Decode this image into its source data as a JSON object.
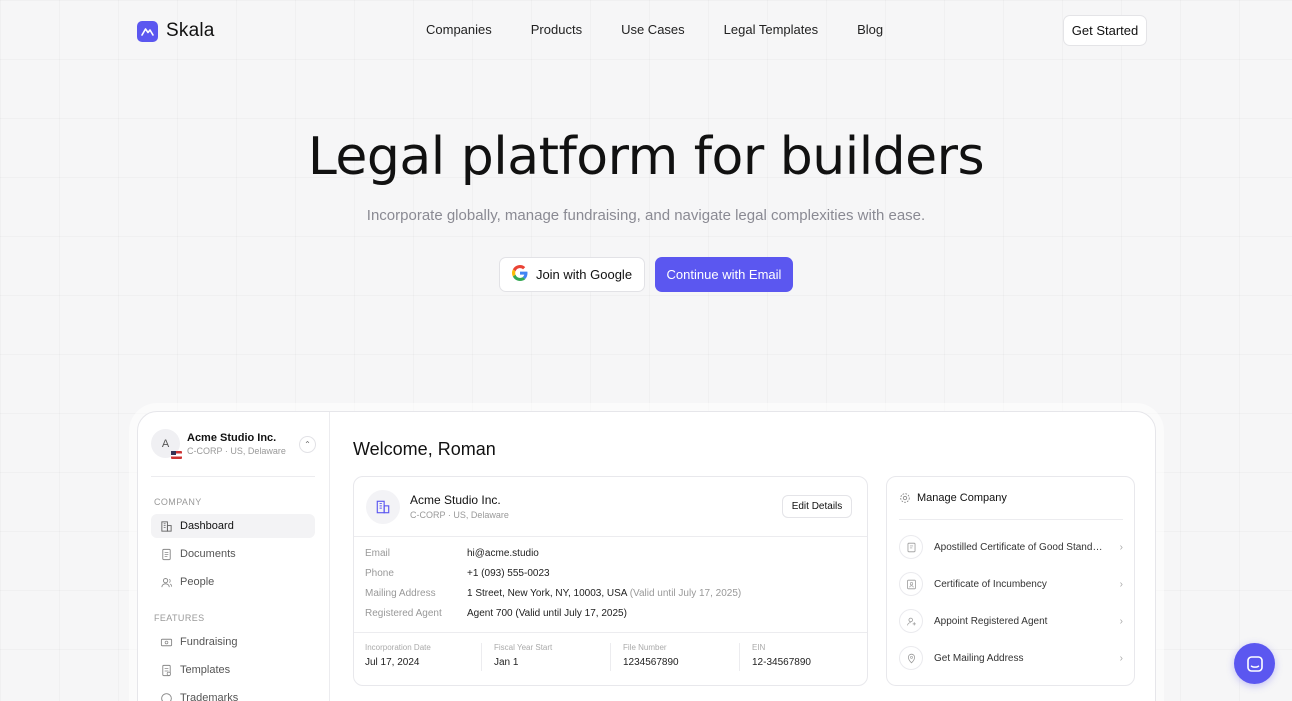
{
  "brand": {
    "name": "Skala",
    "color": "#5b57f0"
  },
  "nav": {
    "links": [
      "Companies",
      "Products",
      "Use Cases",
      "Legal Templates",
      "Blog"
    ],
    "cta": "Get Started"
  },
  "hero": {
    "title": "Legal platform for builders",
    "subtitle": "Incorporate globally, manage fundraising, and navigate legal complexities with ease.",
    "google_button": "Join with Google",
    "email_button": "Continue with Email"
  },
  "app": {
    "org": {
      "initial": "A",
      "name": "Acme Studio Inc.",
      "sub": "C-CORP · US, Delaware"
    },
    "sidebar": {
      "company_label": "COMPANY",
      "company_items": [
        "Dashboard",
        "Documents",
        "People"
      ],
      "features_label": "FEATURES",
      "feature_items": [
        "Fundraising",
        "Templates",
        "Trademarks"
      ]
    },
    "welcome": "Welcome, Roman",
    "company_card": {
      "name": "Acme Studio Inc.",
      "sub": "C-CORP · US, Delaware",
      "edit_label": "Edit Details",
      "rows": [
        {
          "key": "Email",
          "value": "hi@acme.studio",
          "note": ""
        },
        {
          "key": "Phone",
          "value": "+1 (093) 555-0023",
          "note": ""
        },
        {
          "key": "Mailing Address",
          "value": "1 Street, New York, NY, 10003, USA",
          "note": "(Valid until July 17, 2025)"
        },
        {
          "key": "Registered Agent",
          "value": "Agent 700 (Valid until July 17, 2025)",
          "note": ""
        }
      ],
      "meta": [
        {
          "key": "Incorporation Date",
          "value": "Jul 17, 2024"
        },
        {
          "key": "Fiscal Year Start",
          "value": "Jan 1"
        },
        {
          "key": "File Number",
          "value": "1234567890"
        },
        {
          "key": "EIN",
          "value": "12-34567890"
        }
      ]
    },
    "manage_card": {
      "title": "Manage Company",
      "items": [
        "Apostilled Certificate of Good Standing",
        "Certificate of Incumbency",
        "Appoint Registered Agent",
        "Get Mailing Address"
      ]
    }
  }
}
